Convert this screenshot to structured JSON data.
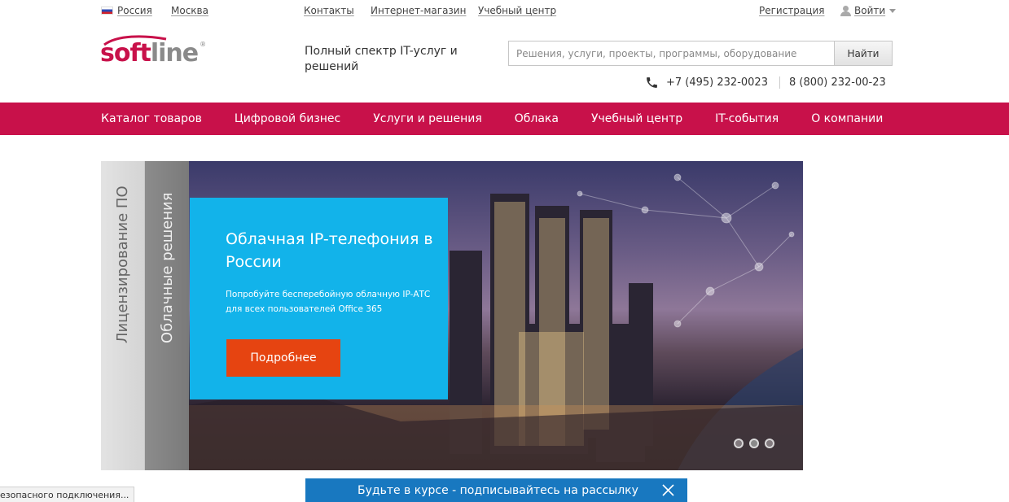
{
  "topbar": {
    "region": "Россия",
    "city": "Москва",
    "links": [
      "Контакты",
      "Интернет-магазин",
      "Учебный центр"
    ],
    "register": "Регистрация",
    "login": "Войти",
    "flag_icon": "russia-flag-icon",
    "user_icon": "user-icon"
  },
  "header": {
    "logo_soft": "soft",
    "logo_line": "line",
    "logo_reg": "®",
    "tagline": "Полный спектр IT-услуг и решений",
    "search_placeholder": "Решения, услуги, проекты, программы, оборудование",
    "search_button": "Найти",
    "phone_icon": "phone-icon",
    "phone1": "+7 (495) 232-0023",
    "phone2": "8 (800) 232-00-23"
  },
  "nav": {
    "items": [
      "Каталог товаров",
      "Цифровой бизнес",
      "Услуги и решения",
      "Облака",
      "Учебный центр",
      "IT-события",
      "О компании"
    ]
  },
  "banner": {
    "tab1": "Лицензирование ПО",
    "tab2": "Облачные решения",
    "title": "Облачная IP-телефония в России",
    "subtitle": "Попробуйте бесперебойную облачную IP-АТС для всех пользователей Office 365",
    "button": "Подробнее",
    "slides": 3,
    "active_slide": 2
  },
  "status_bar": "езопасного подключения...",
  "subscribe": {
    "text": "Будьте в курсе - подписывайтесь на рассылку",
    "close_icon": "close-icon"
  },
  "colors": {
    "brand": "#c8114a",
    "promo": "#12b3ea",
    "cta": "#e64411",
    "subscribe": "#1878c0"
  }
}
